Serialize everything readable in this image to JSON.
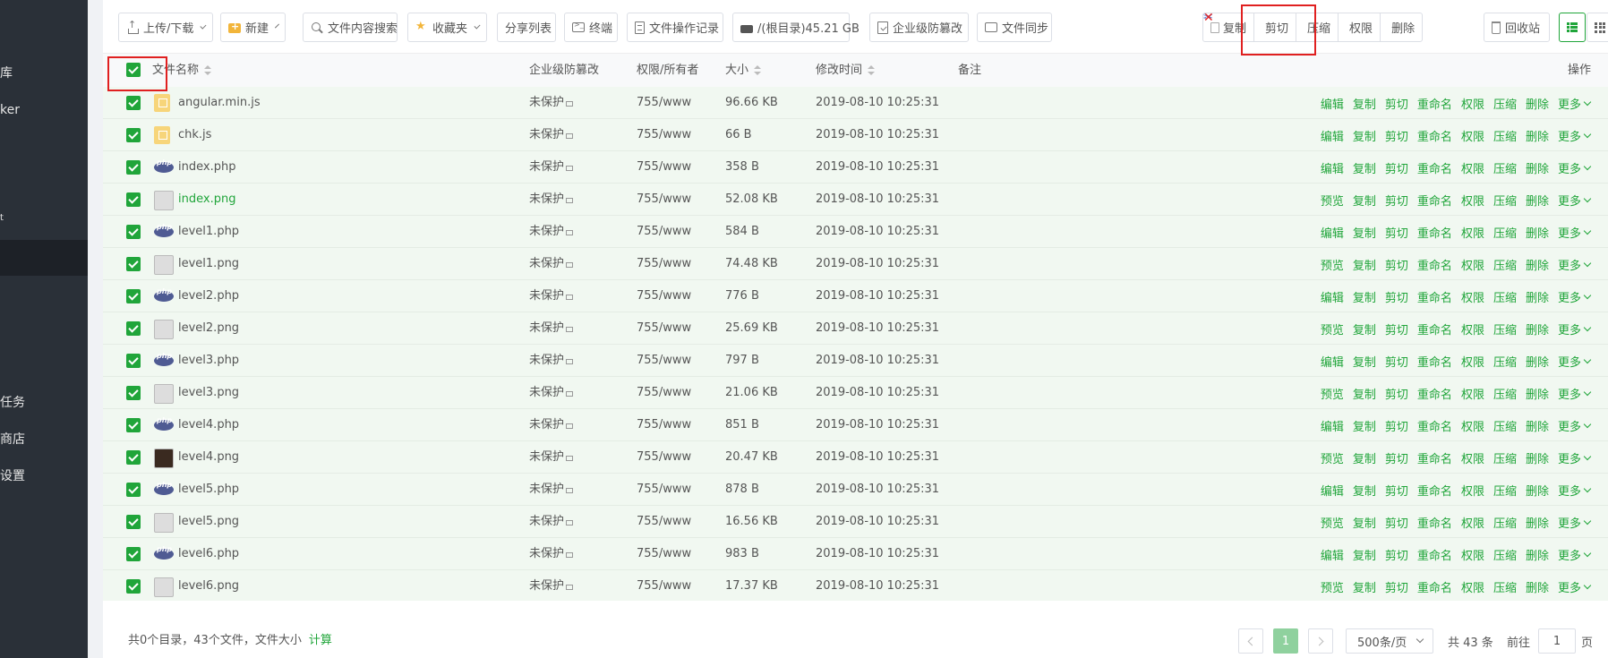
{
  "sidebar": {
    "items": [
      {
        "label": "库"
      },
      {
        "label": "ker"
      },
      {
        "label": "t"
      },
      {
        "label": ""
      },
      {
        "label": "任务"
      },
      {
        "label": "商店"
      },
      {
        "label": "设置"
      }
    ]
  },
  "toolbar": {
    "upload_download": "上传/下载",
    "new": "新建",
    "content_search": "文件内容搜索",
    "favorites": "收藏夹",
    "share_list": "分享列表",
    "terminal": "终端",
    "file_op_log": "文件操作记录",
    "disk": "/(根目录)45.21 GB",
    "tamper_proof": "企业级防篡改",
    "file_sync": "文件同步",
    "batch": {
      "copy": "复制",
      "cut": "剪切",
      "compress": "压缩",
      "permission": "权限",
      "delete": "删除"
    },
    "recycle_bin": "回收站"
  },
  "table": {
    "headers": {
      "name": "文件名称",
      "tamper": "企业级防篡改",
      "perm_owner": "权限/所有者",
      "size": "大小",
      "mtime": "修改时间",
      "note": "备注",
      "ops": "操作"
    },
    "ops_labels": {
      "edit": "编辑",
      "preview": "预览",
      "copy": "复制",
      "cut": "剪切",
      "rename": "重命名",
      "permission": "权限",
      "compress": "压缩",
      "delete": "删除",
      "more": "更多"
    },
    "rows": [
      {
        "name": "angular.min.js",
        "type": "js",
        "tamper": "未保护",
        "perm": "755/www",
        "size": "96.66 KB",
        "mtime": "2019-08-10 10:25:31",
        "first_op": "编辑"
      },
      {
        "name": "chk.js",
        "type": "js",
        "tamper": "未保护",
        "perm": "755/www",
        "size": "66 B",
        "mtime": "2019-08-10 10:25:31",
        "first_op": "编辑"
      },
      {
        "name": "index.php",
        "type": "php",
        "tamper": "未保护",
        "perm": "755/www",
        "size": "358 B",
        "mtime": "2019-08-10 10:25:31",
        "first_op": "编辑"
      },
      {
        "name": "index.png",
        "type": "png",
        "tamper": "未保护",
        "perm": "755/www",
        "size": "52.08 KB",
        "mtime": "2019-08-10 10:25:31",
        "first_op": "预览",
        "name_color": "#20a53a"
      },
      {
        "name": "level1.php",
        "type": "php",
        "tamper": "未保护",
        "perm": "755/www",
        "size": "584 B",
        "mtime": "2019-08-10 10:25:31",
        "first_op": "编辑"
      },
      {
        "name": "level1.png",
        "type": "png",
        "tamper": "未保护",
        "perm": "755/www",
        "size": "74.48 KB",
        "mtime": "2019-08-10 10:25:31",
        "first_op": "预览"
      },
      {
        "name": "level2.php",
        "type": "php",
        "tamper": "未保护",
        "perm": "755/www",
        "size": "776 B",
        "mtime": "2019-08-10 10:25:31",
        "first_op": "编辑"
      },
      {
        "name": "level2.png",
        "type": "png",
        "tamper": "未保护",
        "perm": "755/www",
        "size": "25.69 KB",
        "mtime": "2019-08-10 10:25:31",
        "first_op": "预览"
      },
      {
        "name": "level3.php",
        "type": "php",
        "tamper": "未保护",
        "perm": "755/www",
        "size": "797 B",
        "mtime": "2019-08-10 10:25:31",
        "first_op": "编辑"
      },
      {
        "name": "level3.png",
        "type": "png",
        "tamper": "未保护",
        "perm": "755/www",
        "size": "21.06 KB",
        "mtime": "2019-08-10 10:25:31",
        "first_op": "预览"
      },
      {
        "name": "level4.php",
        "type": "php",
        "tamper": "未保护",
        "perm": "755/www",
        "size": "851 B",
        "mtime": "2019-08-10 10:25:31",
        "first_op": "编辑"
      },
      {
        "name": "level4.png",
        "type": "png-dark",
        "tamper": "未保护",
        "perm": "755/www",
        "size": "20.47 KB",
        "mtime": "2019-08-10 10:25:31",
        "first_op": "预览"
      },
      {
        "name": "level5.php",
        "type": "php",
        "tamper": "未保护",
        "perm": "755/www",
        "size": "878 B",
        "mtime": "2019-08-10 10:25:31",
        "first_op": "编辑"
      },
      {
        "name": "level5.png",
        "type": "png",
        "tamper": "未保护",
        "perm": "755/www",
        "size": "16.56 KB",
        "mtime": "2019-08-10 10:25:31",
        "first_op": "预览"
      },
      {
        "name": "level6.php",
        "type": "php",
        "tamper": "未保护",
        "perm": "755/www",
        "size": "983 B",
        "mtime": "2019-08-10 10:25:31",
        "first_op": "编辑"
      },
      {
        "name": "level6.png",
        "type": "png",
        "tamper": "未保护",
        "perm": "755/www",
        "size": "17.37 KB",
        "mtime": "2019-08-10 10:25:31",
        "first_op": "预览"
      }
    ]
  },
  "footer": {
    "summary": "共0个目录，43个文件，文件大小",
    "calculate": "计算",
    "current_page": "1",
    "per_page": "500条/页",
    "total": "共 43 条",
    "goto_prefix": "前往",
    "goto_value": "1",
    "goto_suffix": "页"
  },
  "colors": {
    "accent": "#20a53a",
    "row_selected_bg": "#f1f8f1",
    "highlight_box": "#e02020",
    "sidebar_bg": "#2a3038"
  }
}
